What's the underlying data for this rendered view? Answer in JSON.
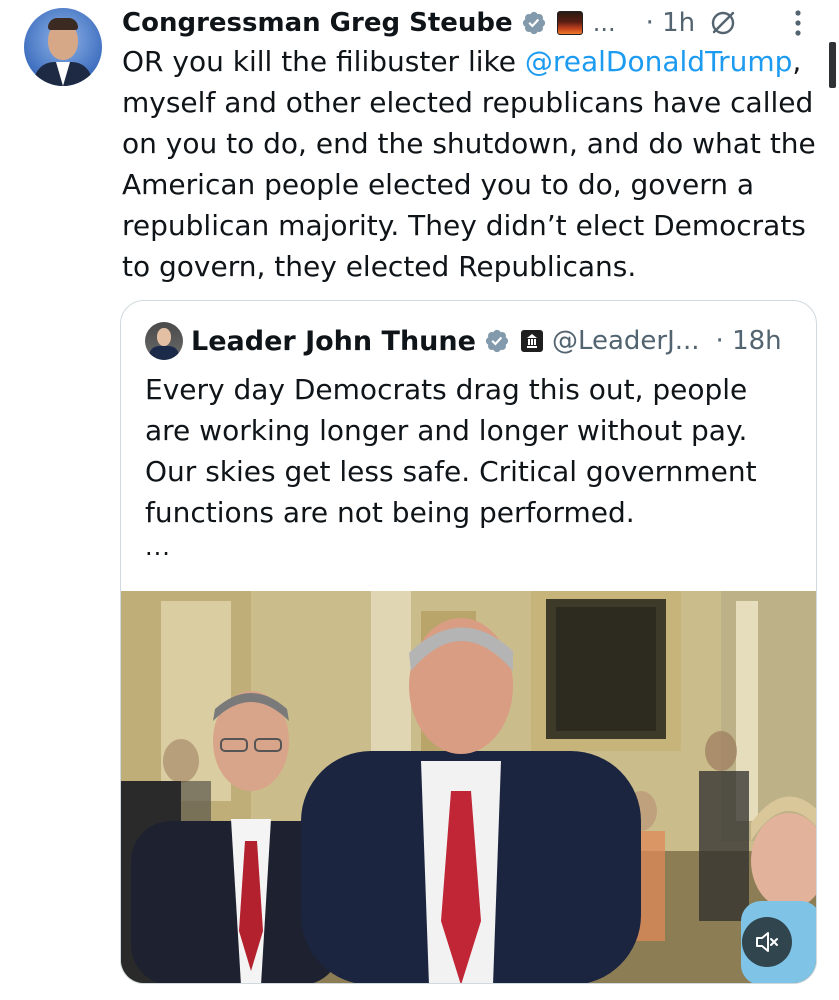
{
  "tweet": {
    "author_name": "Congressman Greg Steube",
    "handle_truncated": "...",
    "time": "· 1h",
    "text_before_mention": "OR you kill the filibuster like ",
    "mention": "@realDonaldTrump",
    "text_after_mention": ", myself and other elected republicans have called on you to do, end the shutdown, and do what the American people elected you to do, govern a republican majority.  They didn’t elect Democrats to govern, they elected Republicans."
  },
  "quote": {
    "author_name": "Leader John Thune",
    "handle": "@LeaderJ...",
    "time": "· 18h",
    "text": "Every day Democrats drag this out, people are working longer and longer without pay. Our skies get less safe. Critical government functions are not being performed.",
    "more": "..."
  },
  "icons": {
    "verified": "verified-badge-icon",
    "grok": "grok-icon",
    "more": "more-vertical-icon",
    "mute": "mute-icon"
  },
  "colors": {
    "accent": "#1d9bf0",
    "text": "#0f1419",
    "secondary": "#536471",
    "border": "#cfd9de"
  }
}
